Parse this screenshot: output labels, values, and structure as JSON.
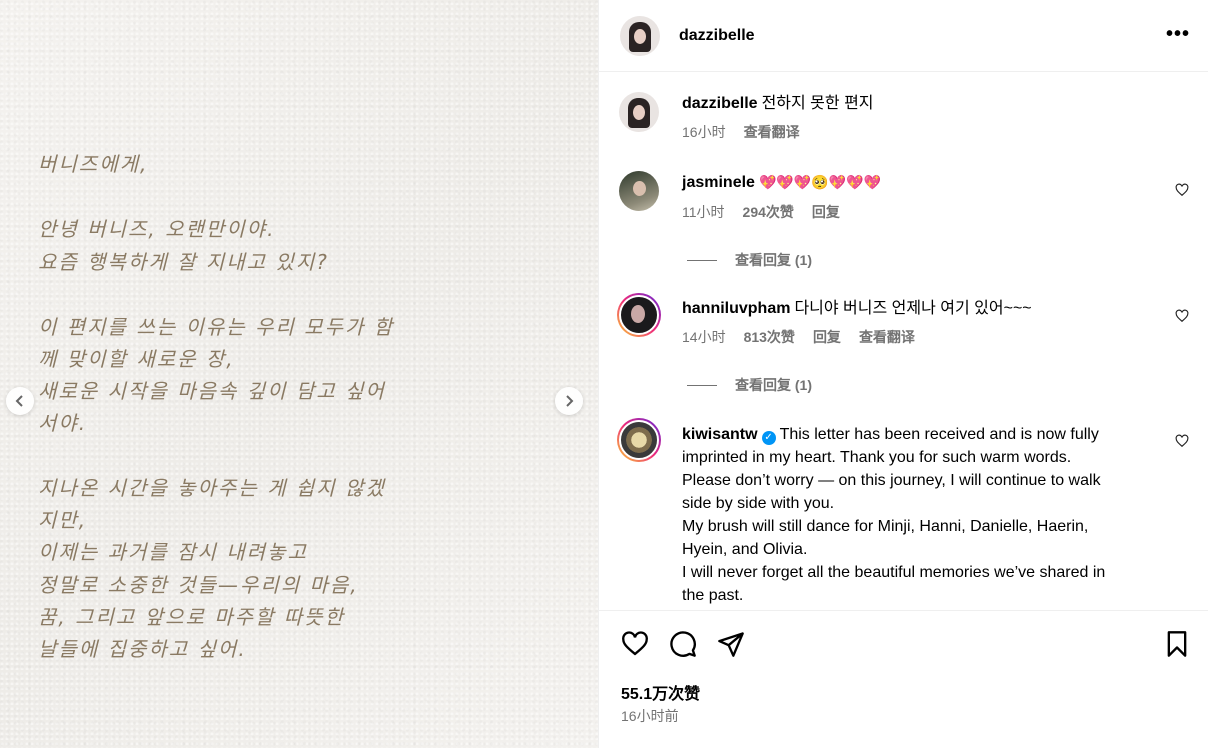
{
  "media": {
    "letter_lines": [
      "버니즈에게,",
      "안녕 버니즈, 오랜만이야.",
      "요즘 행복하게 잘 지내고 있지?",
      "이 편지를 쓰는 이유는 우리 모두가 함",
      "께 맞이할 새로운 장,",
      "새로운 시작을 마음속 깊이 담고 싶어",
      "서야.",
      "지나온 시간을 놓아주는 게 쉽지 않겠",
      "지만,",
      "이제는 과거를 잠시 내려놓고",
      "정말로 소중한 것들—우리의 마음,",
      "꿈, 그리고 앞으로 마주할 따뜻한",
      "날들에 집중하고 싶어."
    ],
    "prev_icon": "chevron-left-icon",
    "next_icon": "chevron-right-icon"
  },
  "header": {
    "username": "dazzibelle",
    "more_icon": "more-horizontal-icon"
  },
  "caption": {
    "username": "dazzibelle",
    "text": "전하지 못한 편지",
    "time": "16小时",
    "translate": "查看翻译"
  },
  "comments": [
    {
      "username": "jasminele",
      "text": "💖💖💖🥺💖💖💖",
      "time": "11小时",
      "likes": "294次赞",
      "reply": "回复",
      "view_replies": "查看回复 (1)"
    },
    {
      "username": "hanniluvpham",
      "text": "다니야 버니즈 언제나 여기 있어~~~",
      "time": "14小时",
      "likes": "813次赞",
      "reply": "回复",
      "translate": "查看翻译",
      "view_replies": "查看回复 (1)"
    },
    {
      "username": "kiwisantw",
      "verified": true,
      "text_lines": [
        "This letter has been received and is now fully",
        "imprinted in my heart. Thank you for such warm words.",
        "Please don’t worry — on this journey, I will continue to walk",
        "side by side with you.",
        "My brush will still dance for Minji, Hanni, Danielle, Haerin,",
        "Hyein, and Olivia.",
        "I will never forget all the beautiful memories we’ve shared in",
        "the past."
      ]
    }
  ],
  "actions": {
    "likes": "55.1万次赞",
    "posted": "16小时前"
  },
  "colors": {
    "letter_ink": "#8a7a63",
    "meta": "#737373",
    "verified": "#0095f6"
  }
}
